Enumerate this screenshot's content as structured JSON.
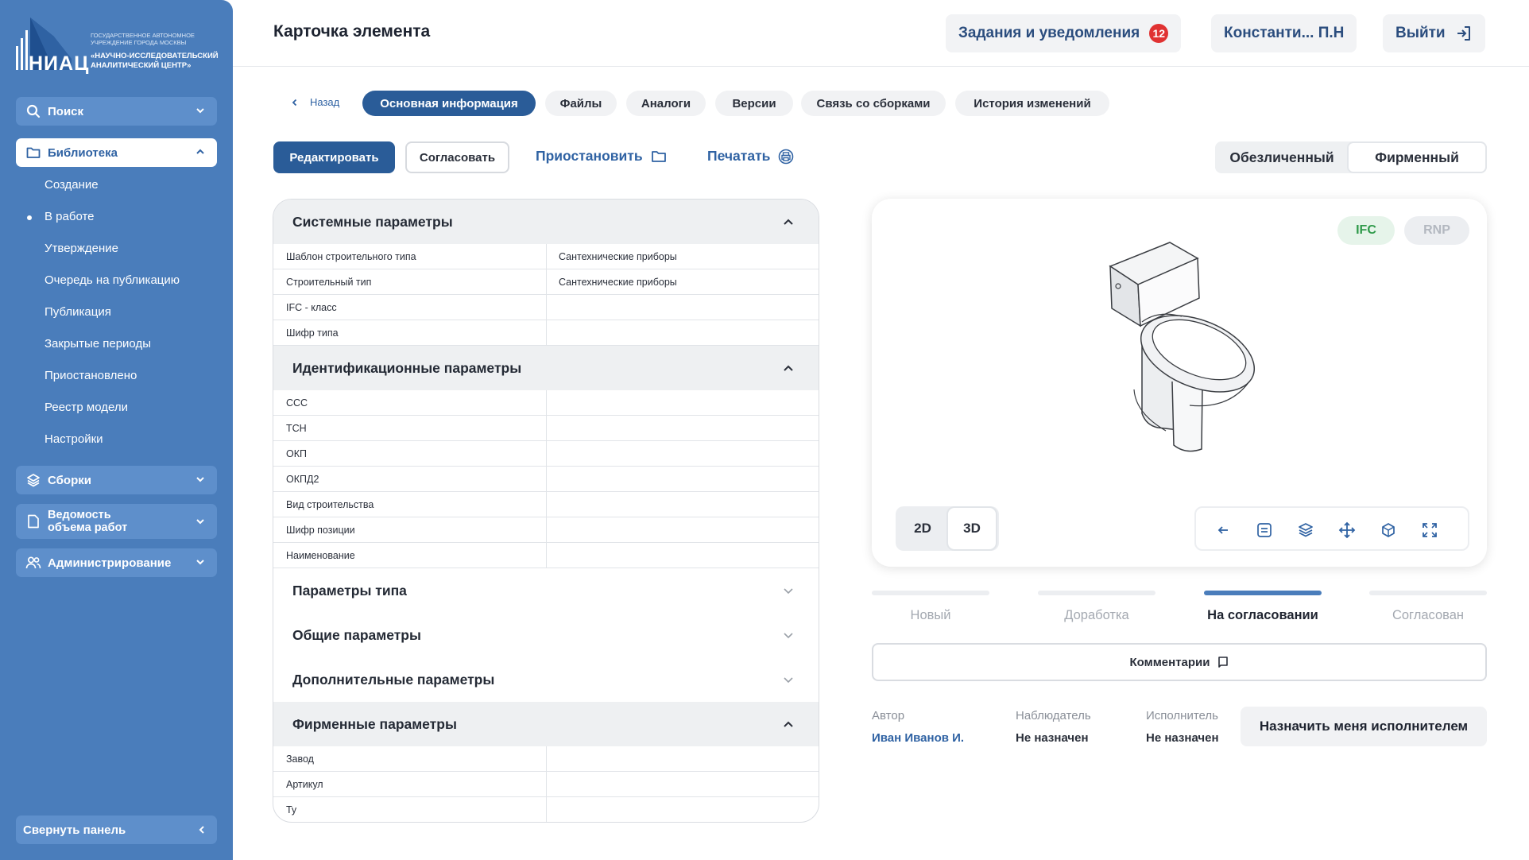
{
  "logo": {
    "abbr": "НИАЦ",
    "small_text": "ГОСУДАРСТВЕННОЕ АВТОНОМНОЕ УЧРЕЖДЕНИЕ ГОРОДА МОСКВЫ",
    "big_text": "«НАУЧНО-ИССЛЕДОВАТЕЛЬСКИЙ АНАЛИТИЧЕСКИЙ ЦЕНТР»"
  },
  "sidebar": {
    "search_label": "Поиск",
    "library_label": "Библиотека",
    "library_items": [
      "Создание",
      "В работе",
      "Утверждение",
      "Очередь на публикацию",
      "Публикация",
      "Закрытые периоды",
      "Приостановлено",
      "Реестр модели",
      "Настройки"
    ],
    "assemblies_label": "Сборки",
    "volume_label_1": "Ведомость",
    "volume_label_2": "объема работ",
    "admin_label": "Администрирование",
    "collapse_label": "Свернуть панель"
  },
  "header": {
    "title": "Карточка элемента",
    "tasks_label": "Задания и уведомления",
    "tasks_count": "12",
    "user_label": "Константи... П.Н",
    "logout_label": "Выйти"
  },
  "tabs": {
    "back_label": "Назад",
    "items": [
      "Основная информация",
      "Файлы",
      "Аналоги",
      "Версии",
      "Связь со сборками",
      "История изменений"
    ]
  },
  "actions": {
    "edit_label": "Редактировать",
    "approve_label": "Согласовать",
    "suspend_label": "Приостановить",
    "print_label": "Печатать",
    "view_anon_label": "Обезличенный",
    "view_brand_label": "Фирменный"
  },
  "params": {
    "system": {
      "title": "Системные параметры",
      "rows": [
        {
          "k": "Шаблон строительного типа",
          "v": "Сантехнические приборы"
        },
        {
          "k": "Строительный тип",
          "v": "Сантехнические приборы"
        },
        {
          "k": "IFC - класс",
          "v": ""
        },
        {
          "k": "Шифр типа",
          "v": ""
        }
      ]
    },
    "ident": {
      "title": "Идентификационные параметры",
      "rows": [
        {
          "k": "ССС",
          "v": ""
        },
        {
          "k": "ТСН",
          "v": ""
        },
        {
          "k": "ОКП",
          "v": ""
        },
        {
          "k": "ОКПД2",
          "v": ""
        },
        {
          "k": "Вид строительства",
          "v": ""
        },
        {
          "k": "Шифр позиции",
          "v": ""
        },
        {
          "k": "Наименование",
          "v": ""
        }
      ]
    },
    "type_title": "Параметры типа",
    "common_title": "Общие параметры",
    "extra_title": "Дополнительные параметры",
    "brand": {
      "title": "Фирменные параметры",
      "rows": [
        {
          "k": "Завод",
          "v": ""
        },
        {
          "k": "Артикул",
          "v": ""
        },
        {
          "k": "Ту",
          "v": ""
        }
      ]
    }
  },
  "viewer": {
    "ifc_label": "IFC",
    "rnp_label": "RNP",
    "mode_2d": "2D",
    "mode_3d": "3D",
    "active_mode": "3D"
  },
  "status": {
    "steps": [
      "Новый",
      "Доработка",
      "На согласовании",
      "Согласован"
    ],
    "current": "На согласовании"
  },
  "comments_label": "Комментарии",
  "meta": {
    "author_key": "Автор",
    "author_value": "Иван Иванов И.",
    "observer_key": "Наблюдатель",
    "observer_value": "Не назначен",
    "executor_key": "Исполнитель",
    "executor_value": "Не назначен",
    "assign_label": "Назначить меня исполнителем"
  },
  "colors": {
    "sidebar": "#4a7dbb",
    "primary": "#2a5c98",
    "link": "#2f62a3",
    "badge": "#e03232",
    "ifc_green": "#2f9a4a"
  }
}
